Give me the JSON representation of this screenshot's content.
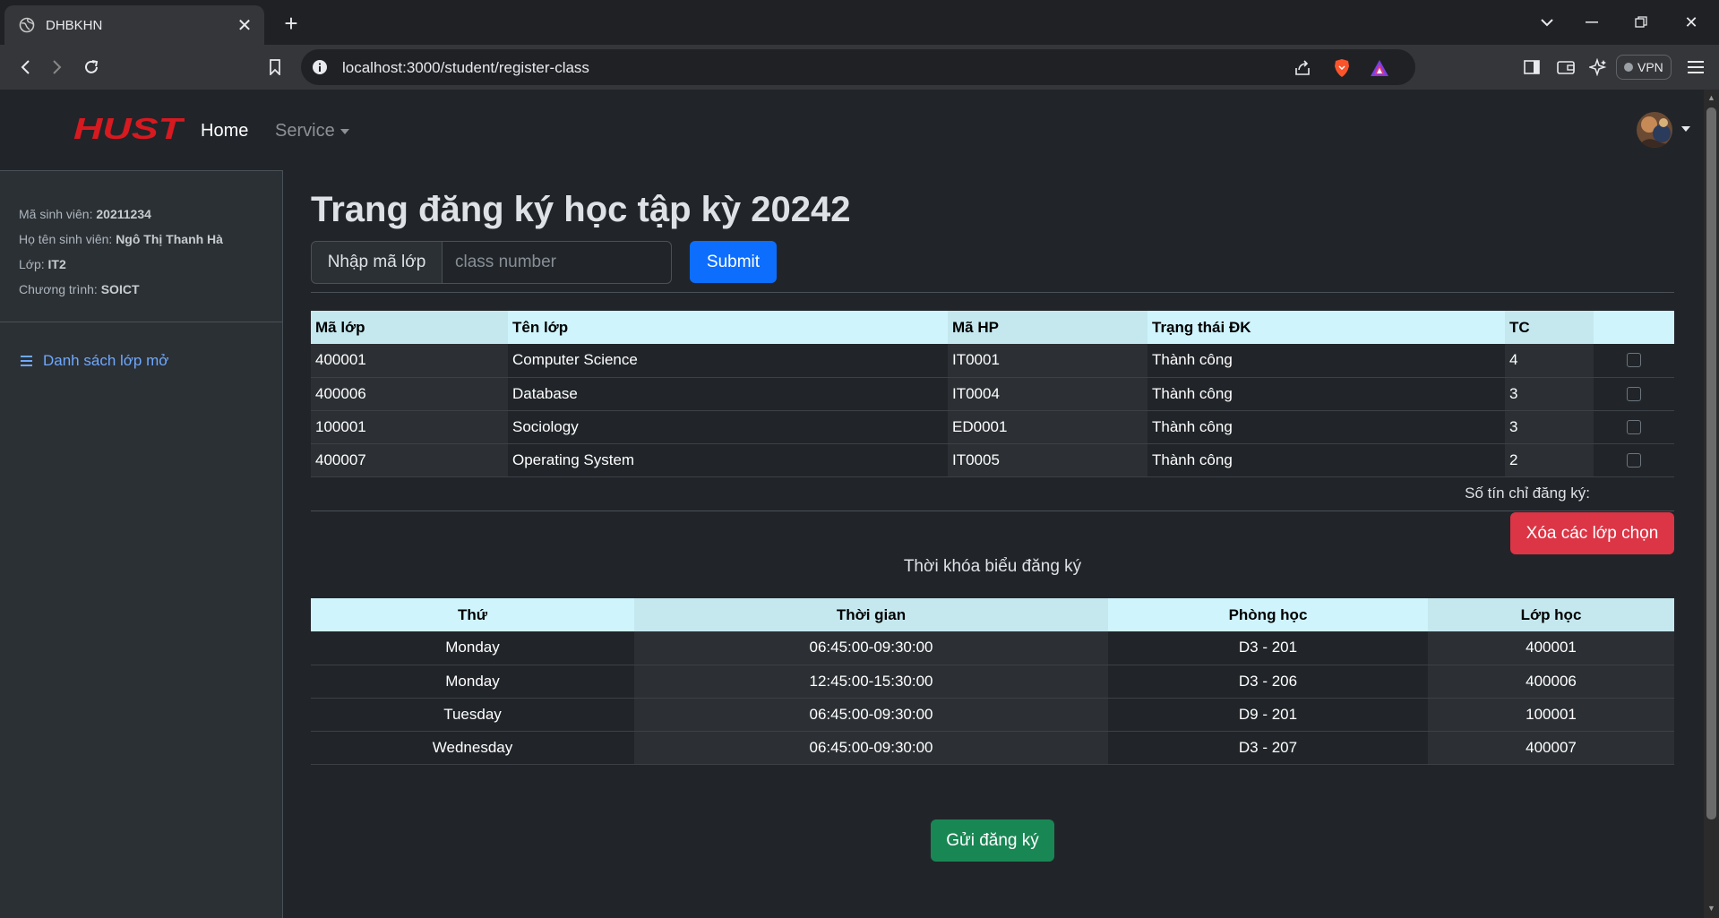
{
  "browser": {
    "tab_title": "DHBKHN",
    "url": "localhost:3000/student/register-class",
    "vpn_label": "VPN"
  },
  "nav": {
    "logo_text": "HUST",
    "home": "Home",
    "service": "Service"
  },
  "student": {
    "id_label": "Mã sinh viên:",
    "id": "20211234",
    "name_label": "Họ tên sinh viên:",
    "name": "Ngô Thị Thanh Hà",
    "class_label": "Lớp:",
    "class": "IT2",
    "program_label": "Chương trình:",
    "program": "SOICT"
  },
  "sidebar": {
    "open_classes_link": "Danh sách lớp mở"
  },
  "main": {
    "title": "Trang đăng ký học tập kỳ 20242",
    "input_label": "Nhập mã lớp",
    "input_placeholder": "class number",
    "submit": "Submit",
    "credits_label": "Số tín chỉ đăng ký:",
    "delete_button": "Xóa các lớp chọn",
    "timetable_title": "Thời khóa biểu đăng ký",
    "send_button": "Gửi đăng ký"
  },
  "classes_table": {
    "headers": [
      "Mã lớp",
      "Tên lớp",
      "Mã HP",
      "Trạng thái ĐK",
      "TC",
      ""
    ],
    "rows": [
      [
        "400001",
        "Computer Science",
        "IT0001",
        "Thành công",
        "4"
      ],
      [
        "400006",
        "Database",
        "IT0004",
        "Thành công",
        "3"
      ],
      [
        "100001",
        "Sociology",
        "ED0001",
        "Thành công",
        "3"
      ],
      [
        "400007",
        "Operating System",
        "IT0005",
        "Thành công",
        "2"
      ]
    ]
  },
  "timetable": {
    "headers": [
      "Thứ",
      "Thời gian",
      "Phòng học",
      "Lớp học"
    ],
    "rows": [
      [
        "Monday",
        "06:45:00-09:30:00",
        "D3 - 201",
        "400001"
      ],
      [
        "Monday",
        "12:45:00-15:30:00",
        "D3 - 206",
        "400006"
      ],
      [
        "Tuesday",
        "06:45:00-09:30:00",
        "D9 - 201",
        "100001"
      ],
      [
        "Wednesday",
        "06:45:00-09:30:00",
        "D3 - 207",
        "400007"
      ]
    ]
  },
  "colors": {
    "logo_red": "#d71920",
    "primary": "#0d6efd",
    "danger": "#dc3545",
    "success": "#198754",
    "table_header": "#cff4fc",
    "link": "#6ea8fe"
  }
}
